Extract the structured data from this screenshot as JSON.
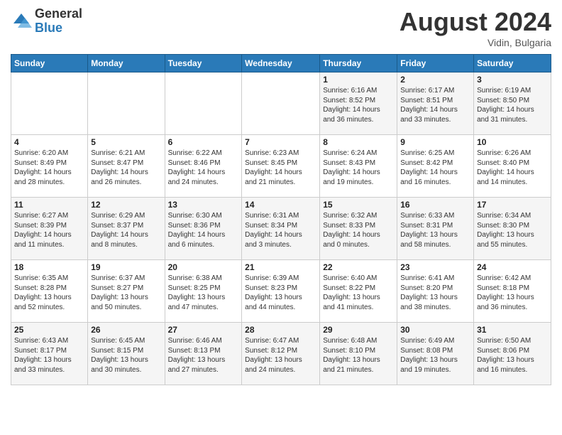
{
  "header": {
    "logo_general": "General",
    "logo_blue": "Blue",
    "month_title": "August 2024",
    "location": "Vidin, Bulgaria"
  },
  "days_of_week": [
    "Sunday",
    "Monday",
    "Tuesday",
    "Wednesday",
    "Thursday",
    "Friday",
    "Saturday"
  ],
  "weeks": [
    [
      {
        "day": "",
        "info": ""
      },
      {
        "day": "",
        "info": ""
      },
      {
        "day": "",
        "info": ""
      },
      {
        "day": "",
        "info": ""
      },
      {
        "day": "1",
        "info": "Sunrise: 6:16 AM\nSunset: 8:52 PM\nDaylight: 14 hours\nand 36 minutes."
      },
      {
        "day": "2",
        "info": "Sunrise: 6:17 AM\nSunset: 8:51 PM\nDaylight: 14 hours\nand 33 minutes."
      },
      {
        "day": "3",
        "info": "Sunrise: 6:19 AM\nSunset: 8:50 PM\nDaylight: 14 hours\nand 31 minutes."
      }
    ],
    [
      {
        "day": "4",
        "info": "Sunrise: 6:20 AM\nSunset: 8:49 PM\nDaylight: 14 hours\nand 28 minutes."
      },
      {
        "day": "5",
        "info": "Sunrise: 6:21 AM\nSunset: 8:47 PM\nDaylight: 14 hours\nand 26 minutes."
      },
      {
        "day": "6",
        "info": "Sunrise: 6:22 AM\nSunset: 8:46 PM\nDaylight: 14 hours\nand 24 minutes."
      },
      {
        "day": "7",
        "info": "Sunrise: 6:23 AM\nSunset: 8:45 PM\nDaylight: 14 hours\nand 21 minutes."
      },
      {
        "day": "8",
        "info": "Sunrise: 6:24 AM\nSunset: 8:43 PM\nDaylight: 14 hours\nand 19 minutes."
      },
      {
        "day": "9",
        "info": "Sunrise: 6:25 AM\nSunset: 8:42 PM\nDaylight: 14 hours\nand 16 minutes."
      },
      {
        "day": "10",
        "info": "Sunrise: 6:26 AM\nSunset: 8:40 PM\nDaylight: 14 hours\nand 14 minutes."
      }
    ],
    [
      {
        "day": "11",
        "info": "Sunrise: 6:27 AM\nSunset: 8:39 PM\nDaylight: 14 hours\nand 11 minutes."
      },
      {
        "day": "12",
        "info": "Sunrise: 6:29 AM\nSunset: 8:37 PM\nDaylight: 14 hours\nand 8 minutes."
      },
      {
        "day": "13",
        "info": "Sunrise: 6:30 AM\nSunset: 8:36 PM\nDaylight: 14 hours\nand 6 minutes."
      },
      {
        "day": "14",
        "info": "Sunrise: 6:31 AM\nSunset: 8:34 PM\nDaylight: 14 hours\nand 3 minutes."
      },
      {
        "day": "15",
        "info": "Sunrise: 6:32 AM\nSunset: 8:33 PM\nDaylight: 14 hours\nand 0 minutes."
      },
      {
        "day": "16",
        "info": "Sunrise: 6:33 AM\nSunset: 8:31 PM\nDaylight: 13 hours\nand 58 minutes."
      },
      {
        "day": "17",
        "info": "Sunrise: 6:34 AM\nSunset: 8:30 PM\nDaylight: 13 hours\nand 55 minutes."
      }
    ],
    [
      {
        "day": "18",
        "info": "Sunrise: 6:35 AM\nSunset: 8:28 PM\nDaylight: 13 hours\nand 52 minutes."
      },
      {
        "day": "19",
        "info": "Sunrise: 6:37 AM\nSunset: 8:27 PM\nDaylight: 13 hours\nand 50 minutes."
      },
      {
        "day": "20",
        "info": "Sunrise: 6:38 AM\nSunset: 8:25 PM\nDaylight: 13 hours\nand 47 minutes."
      },
      {
        "day": "21",
        "info": "Sunrise: 6:39 AM\nSunset: 8:23 PM\nDaylight: 13 hours\nand 44 minutes."
      },
      {
        "day": "22",
        "info": "Sunrise: 6:40 AM\nSunset: 8:22 PM\nDaylight: 13 hours\nand 41 minutes."
      },
      {
        "day": "23",
        "info": "Sunrise: 6:41 AM\nSunset: 8:20 PM\nDaylight: 13 hours\nand 38 minutes."
      },
      {
        "day": "24",
        "info": "Sunrise: 6:42 AM\nSunset: 8:18 PM\nDaylight: 13 hours\nand 36 minutes."
      }
    ],
    [
      {
        "day": "25",
        "info": "Sunrise: 6:43 AM\nSunset: 8:17 PM\nDaylight: 13 hours\nand 33 minutes."
      },
      {
        "day": "26",
        "info": "Sunrise: 6:45 AM\nSunset: 8:15 PM\nDaylight: 13 hours\nand 30 minutes."
      },
      {
        "day": "27",
        "info": "Sunrise: 6:46 AM\nSunset: 8:13 PM\nDaylight: 13 hours\nand 27 minutes."
      },
      {
        "day": "28",
        "info": "Sunrise: 6:47 AM\nSunset: 8:12 PM\nDaylight: 13 hours\nand 24 minutes."
      },
      {
        "day": "29",
        "info": "Sunrise: 6:48 AM\nSunset: 8:10 PM\nDaylight: 13 hours\nand 21 minutes."
      },
      {
        "day": "30",
        "info": "Sunrise: 6:49 AM\nSunset: 8:08 PM\nDaylight: 13 hours\nand 19 minutes."
      },
      {
        "day": "31",
        "info": "Sunrise: 6:50 AM\nSunset: 8:06 PM\nDaylight: 13 hours\nand 16 minutes."
      }
    ]
  ]
}
